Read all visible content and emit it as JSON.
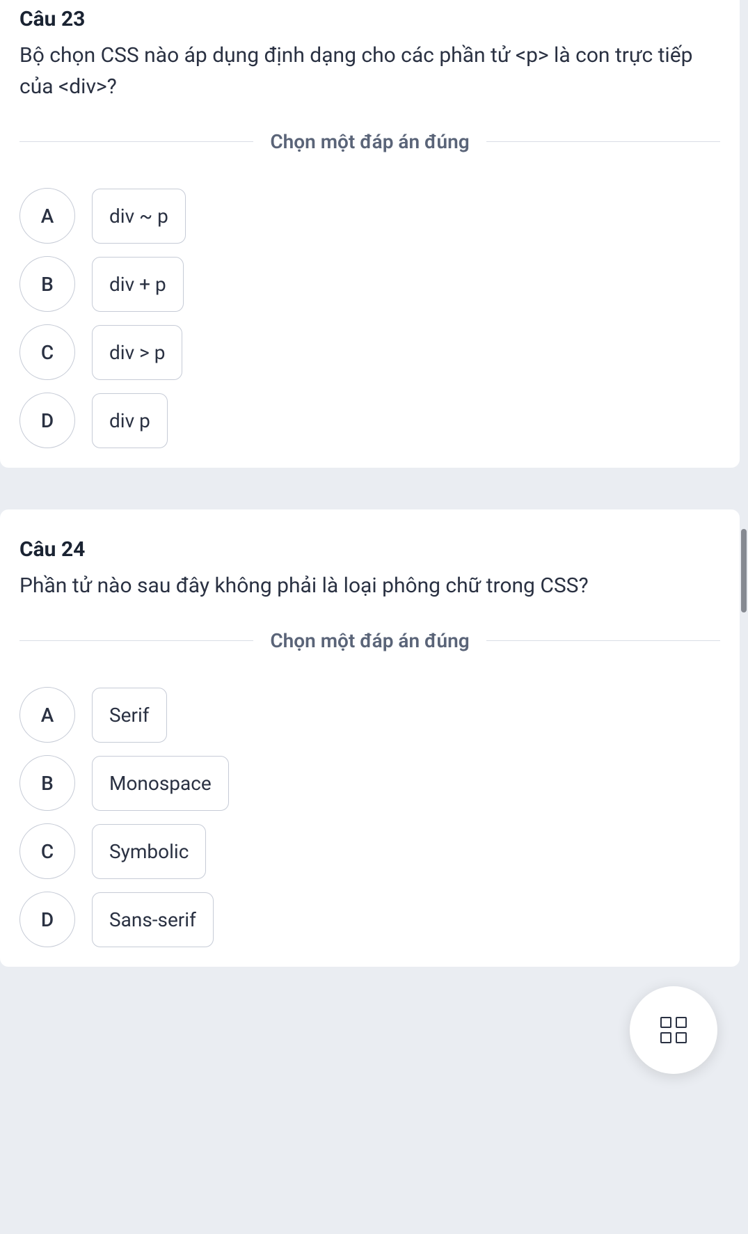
{
  "questions": [
    {
      "title": "Câu 23",
      "text": "Bộ chọn CSS nào áp dụng định dạng cho các phần tử <p> là con trực tiếp của <div>?",
      "instruction": "Chọn một đáp án đúng",
      "options": [
        {
          "letter": "A",
          "text": "div ~ p"
        },
        {
          "letter": "B",
          "text": "div + p"
        },
        {
          "letter": "C",
          "text": "div > p"
        },
        {
          "letter": "D",
          "text": "div p"
        }
      ]
    },
    {
      "title": "Câu 24",
      "text": "Phần tử nào sau đây không phải là loại phông chữ trong CSS?",
      "instruction": "Chọn một đáp án đúng",
      "options": [
        {
          "letter": "A",
          "text": "Serif"
        },
        {
          "letter": "B",
          "text": "Monospace"
        },
        {
          "letter": "C",
          "text": "Symbolic"
        },
        {
          "letter": "D",
          "text": "Sans-serif"
        }
      ]
    }
  ]
}
